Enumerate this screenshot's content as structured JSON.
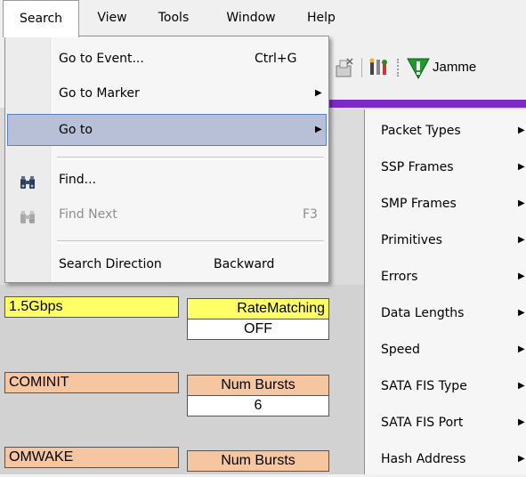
{
  "menubar": {
    "items": [
      "Search",
      "View",
      "Tools",
      "Window",
      "Help"
    ]
  },
  "search_menu": {
    "items": [
      {
        "label": "Go to Event...",
        "shortcut": "Ctrl+G"
      },
      {
        "label": "Go to Marker",
        "has_submenu": true
      },
      {
        "label": "Go to",
        "has_submenu": true,
        "selected": true
      },
      {
        "label": "Find...",
        "icon": "binoculars-icon"
      },
      {
        "label": "Find Next",
        "shortcut": "F3",
        "disabled": true,
        "icon": "binoculars-next-icon"
      },
      {
        "label": "Search Direction",
        "value": "Backward"
      }
    ]
  },
  "goto_submenu": {
    "items": [
      "Packet Types",
      "SSP Frames",
      "SMP Frames",
      "Primitives",
      "Errors",
      "Data Lengths",
      "Speed",
      "SATA FIS Type",
      "SATA FIS Port",
      "Hash Address"
    ]
  },
  "toolbar": {
    "jammer_label": "Jamme"
  },
  "background_cells": {
    "speed": "1.5Gbps",
    "rate_matching_label": "RateMatching",
    "rate_matching_value": "OFF",
    "cominit": "COMINIT",
    "num_bursts_label_1": "Num Bursts",
    "num_bursts_value_1": "6",
    "comwake": "OMWAKE",
    "num_bursts_label_2": "Num Bursts"
  },
  "colors": {
    "selection": "#b7c0d6",
    "purple_strip": "#7c2ac6",
    "yellow_cell": "#ffff66",
    "peach_cell": "#f5c6a0"
  }
}
